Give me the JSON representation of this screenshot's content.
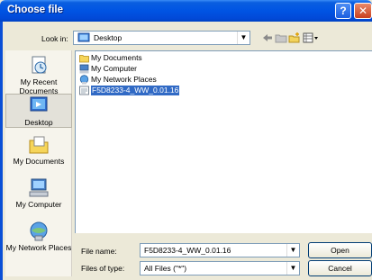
{
  "window": {
    "title": "Choose file",
    "help_glyph": "?",
    "close_glyph": "✕"
  },
  "toolbar": {
    "look_in_label": "Look in:",
    "look_in_value": "Desktop",
    "icons": [
      "back-icon",
      "up-folder-icon",
      "new-folder-icon",
      "view-menu-icon"
    ]
  },
  "places": [
    {
      "label": "My Recent Documents",
      "icon": "recent-documents-icon"
    },
    {
      "label": "Desktop",
      "icon": "desktop-icon",
      "selected": true
    },
    {
      "label": "My Documents",
      "icon": "my-documents-icon"
    },
    {
      "label": "My Computer",
      "icon": "my-computer-icon"
    },
    {
      "label": "My Network Places",
      "icon": "network-places-icon"
    }
  ],
  "files": [
    {
      "name": "My Documents",
      "icon": "folder-icon"
    },
    {
      "name": "My Computer",
      "icon": "computer-icon"
    },
    {
      "name": "My Network Places",
      "icon": "network-icon"
    },
    {
      "name": "F5D8233-4_WW_0.01.16",
      "icon": "file-icon",
      "selected": true
    }
  ],
  "footer": {
    "file_name_label": "File name:",
    "file_name_value": "F5D8233-4_WW_0.01.16",
    "file_type_label": "Files of type:",
    "file_type_value": "All Files (\"*\")",
    "open_label": "Open",
    "cancel_label": "Cancel"
  }
}
